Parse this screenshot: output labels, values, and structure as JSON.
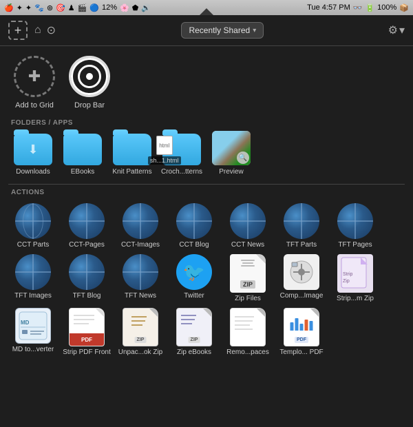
{
  "menubar": {
    "time": "Tue 4:57 PM",
    "battery": "100%",
    "percent": "12%"
  },
  "toolbar": {
    "add_label": "+",
    "dropdown_label": "Recently Shared",
    "dropdown_arrow": "▾",
    "gear_label": "⚙",
    "gear_arrow": "▾"
  },
  "quick_actions": {
    "add_to_grid_label": "Add to Grid",
    "drop_bar_label": "Drop Bar"
  },
  "sections": {
    "folders_header": "FOLDERS / APPS",
    "actions_header": "ACTIONS"
  },
  "folders": [
    {
      "label": "Downloads",
      "type": "download"
    },
    {
      "label": "EBooks",
      "type": "folder"
    },
    {
      "label": "Knit Patterns",
      "type": "folder"
    },
    {
      "label": "Croch...tterns",
      "type": "folder"
    },
    {
      "label": "Preview",
      "type": "preview"
    }
  ],
  "dragged_file": {
    "label": "sh...1.html"
  },
  "actions_row1": [
    {
      "label": "CCT Parts",
      "type": "globe"
    },
    {
      "label": "CCT-Pages",
      "type": "globe"
    },
    {
      "label": "CCT-Images",
      "type": "globe"
    },
    {
      "label": "CCT Blog",
      "type": "globe"
    },
    {
      "label": "CCT News",
      "type": "globe"
    },
    {
      "label": "TFT Parts",
      "type": "globe"
    },
    {
      "label": "TFT Pages",
      "type": "globe"
    }
  ],
  "actions_row2": [
    {
      "label": "TFT Images",
      "type": "globe"
    },
    {
      "label": "TFT Blog",
      "type": "globe"
    },
    {
      "label": "TFT News",
      "type": "globe"
    },
    {
      "label": "Twitter",
      "type": "twitter"
    },
    {
      "label": "Zip Files",
      "type": "zip"
    },
    {
      "label": "Comp...Image",
      "type": "compress"
    },
    {
      "label": "Strip...m Zip",
      "type": "stripzip"
    }
  ],
  "actions_row3": [
    {
      "label": "MD to...verter",
      "type": "md"
    },
    {
      "label": "Strip PDF Front",
      "type": "strippdf"
    },
    {
      "label": "Unpac...ok Zip",
      "type": "unpack"
    },
    {
      "label": "Zip eBooks",
      "type": "zipe"
    },
    {
      "label": "Remo...paces",
      "type": "remo"
    },
    {
      "label": "Templo... PDF",
      "type": "templ"
    }
  ]
}
